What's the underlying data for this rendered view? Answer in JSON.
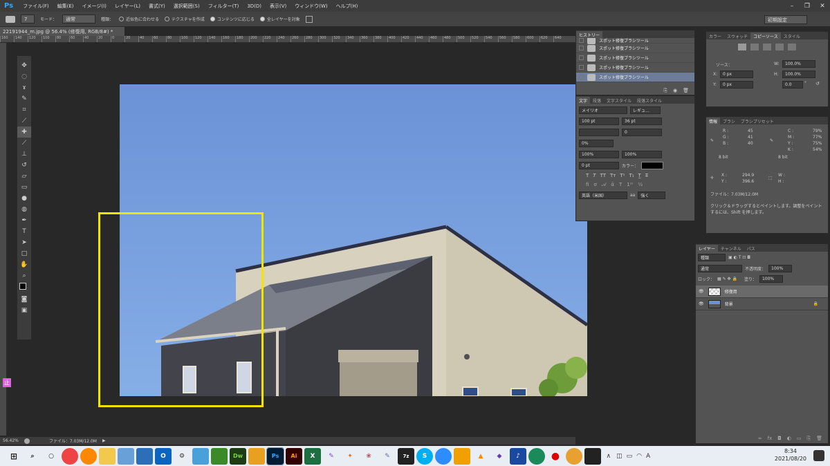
{
  "menubar": {
    "logo": "Ps",
    "items": [
      "ファイル(F)",
      "編集(E)",
      "イメージ(I)",
      "レイヤー(L)",
      "書式(Y)",
      "選択範囲(S)",
      "フィルター(T)",
      "3D(D)",
      "表示(V)",
      "ウィンドウ(W)",
      "ヘルプ(H)"
    ]
  },
  "options": {
    "brush_size": "7",
    "mode_label": "モード：",
    "mode_value": "通常",
    "type_label": "種類：",
    "opt1": "近似色に合わせる",
    "opt2": "テクスチャを作成",
    "opt3": "コンテンツに応じる",
    "sample_all": "全レイヤーを対象",
    "workspace": "初期設定"
  },
  "document": {
    "tab": "22191944_m.jpg @ 56.4% (修復用, RGB/8#) *",
    "zoom": "56.42%",
    "file_info": "ファイル：7.03M/12.0M"
  },
  "ruler_ticks": [
    "160",
    "140",
    "120",
    "100",
    "80",
    "60",
    "40",
    "20",
    "0",
    "20",
    "40",
    "60",
    "80",
    "100",
    "120",
    "140",
    "160",
    "180",
    "200",
    "220",
    "240",
    "260",
    "280",
    "300",
    "320",
    "340",
    "360",
    "380",
    "400",
    "420",
    "440",
    "460",
    "480",
    "500",
    "520",
    "540",
    "560",
    "580",
    "600",
    "620",
    "640"
  ],
  "tools": [
    "移動",
    "選択",
    "投げ縄",
    "クイック選択",
    "切り抜き",
    "スポイト",
    "修復",
    "ブラシ",
    "スタンプ",
    "ヒストリー",
    "消しゴム",
    "グラデーション",
    "ぼかし",
    "覆い焼き",
    "ペン",
    "文字",
    "パス選択",
    "長方形",
    "手のひら",
    "ズーム"
  ],
  "stop_badge": "止",
  "history": {
    "tab": "ヒストリー",
    "items": [
      "スポット修復ブラシツール",
      "スポット修復ブラシツール",
      "スポット修復ブラシツール",
      "スポット修復ブラシツール",
      "スポット修復ブラシツール"
    ]
  },
  "character": {
    "tabs": [
      "文字",
      "段落",
      "文字スタイル",
      "段落スタイル"
    ],
    "font": "メイリオ",
    "style": "レギュ...",
    "size": "100 pt",
    "leading": "36 pt",
    "kerning": "",
    "tracking": "0",
    "scale_pct": "0%",
    "vscale": "100%",
    "hscale": "100%",
    "baseline": "0 pt",
    "color_label": "カラー：",
    "lang": "英語（米国）",
    "aa_label": "aa",
    "aa": "強く"
  },
  "clone_source": {
    "tabs": [
      "カラー",
      "スウォッチ",
      "コピーソース",
      "スタイル"
    ],
    "source_label": "ソース：",
    "x_label": "X:",
    "x": "0 px",
    "y_label": "Y:",
    "y": "0 px",
    "w_label": "W:",
    "w": "100.0%",
    "h_label": "H:",
    "h": "100.0%",
    "angle": "0.0",
    "angle_unit": "°"
  },
  "info": {
    "tabs": [
      "情報",
      "ブラシ",
      "ブラシプリセット"
    ],
    "r_label": "R :",
    "r": "45",
    "g_label": "G :",
    "g": "41",
    "b_label": "B :",
    "b": "40",
    "c_label": "C :",
    "c": "79%",
    "m_label": "M :",
    "m": "77%",
    "yy_label": "Y :",
    "yy": "75%",
    "k_label": "K :",
    "k": "54%",
    "bit1": "8 bit",
    "bit2": "8 bit",
    "x_label": "X :",
    "x": "294.9",
    "y_label": "Y :",
    "y": "396.6",
    "w_label": "W :",
    "h_label": "H :",
    "file": "ファイル：7.03M/12.0M",
    "hint": "クリック＆ドラッグするとペイントします。調整をペイントするには、Shift を押します。"
  },
  "layers": {
    "tabs": [
      "レイヤー",
      "チャンネル",
      "パス"
    ],
    "kind": "種類",
    "blend": "通常",
    "opacity_label": "不透明度：",
    "opacity": "100%",
    "lock_label": "ロック：",
    "fill_label": "塗り：",
    "fill": "100%",
    "items": [
      {
        "name": "修復用"
      },
      {
        "name": "背景"
      }
    ]
  },
  "clock": {
    "time": "8:34",
    "date": "2021/08/20"
  },
  "taskbar_icons": [
    "ps-label",
    "ai-label",
    "dw-label"
  ],
  "colors": {
    "accent": "#31a8ff",
    "highlight": "#f2e600"
  }
}
